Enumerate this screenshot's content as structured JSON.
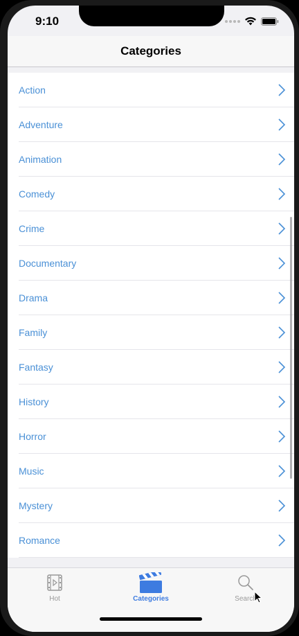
{
  "status": {
    "time": "9:10"
  },
  "nav": {
    "title": "Categories"
  },
  "categories": [
    "Action",
    "Adventure",
    "Animation",
    "Comedy",
    "Crime",
    "Documentary",
    "Drama",
    "Family",
    "Fantasy",
    "History",
    "Horror",
    "Music",
    "Mystery",
    "Romance"
  ],
  "tabs": [
    {
      "label": "Hot",
      "icon": "film-icon"
    },
    {
      "label": "Categories",
      "icon": "clapperboard-icon"
    },
    {
      "label": "Search",
      "icon": "search-icon"
    }
  ],
  "colors": {
    "accent": "#3d7be0",
    "row_text": "#4a90d6",
    "inactive_tab": "#999999"
  }
}
